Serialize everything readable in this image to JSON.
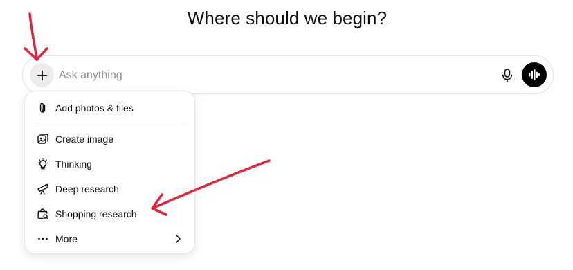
{
  "heading": "Where should we begin?",
  "composer": {
    "placeholder": "Ask anything",
    "value": ""
  },
  "menu": {
    "items": [
      {
        "label": "Add photos & files",
        "icon": "paperclip-icon"
      },
      {
        "label": "Create image",
        "icon": "image-icon"
      },
      {
        "label": "Thinking",
        "icon": "lightbulb-icon"
      },
      {
        "label": "Deep research",
        "icon": "telescope-icon"
      },
      {
        "label": "Shopping research",
        "icon": "shopping-bag-search-icon"
      },
      {
        "label": "More",
        "icon": "more-dots-icon"
      }
    ]
  },
  "colors": {
    "annotation_arrow": "#e5243b",
    "voice_button": "#000000",
    "plus_button_bg": "#ececec"
  }
}
